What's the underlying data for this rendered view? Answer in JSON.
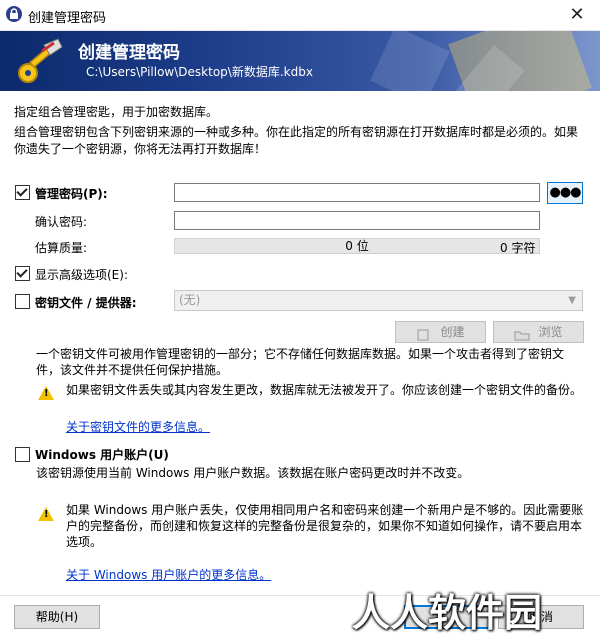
{
  "window": {
    "title": "创建管理密码"
  },
  "banner": {
    "title": "创建管理密码",
    "path": "C:\\Users\\Pillow\\Desktop\\新数据库.kdbx"
  },
  "intro": {
    "line1": "指定组合管理密匙，用于加密数据库。",
    "line2": "组合管理密钥包含下列密钥来源的一种或多种。你在此指定的所有密钥源在打开数据库时都是必须的。如果你遗失了一个密钥源，你将无法再打开数据库！"
  },
  "master_password": {
    "label": "管理密码(P):",
    "checked": true,
    "value": "",
    "dots_label": "●●●",
    "confirm_label": "确认密码:",
    "confirm_value": "",
    "quality_label": "估算质量:",
    "quality_value": "0 位",
    "char_count": "0 字符"
  },
  "advanced": {
    "label": "显示高级选项(E):",
    "checked": true
  },
  "key_file": {
    "label": "密钥文件 / 提供器:",
    "checked": false,
    "selected": "(无)",
    "create_label": "创建",
    "browse_label": "浏览",
    "desc": "一个密钥文件可被用作管理密钥的一部分；它不存储任何数据库数据。如果一个攻击者得到了密钥文件，该文件并不提供任何保护措施。",
    "warning": "如果密钥文件丢失或其内容发生更改，数据库就无法被发开了。你应该创建一个密钥文件的备份。",
    "link": "关于密钥文件的更多信息。"
  },
  "windows_account": {
    "label": "Windows 用户账户(U)",
    "checked": false,
    "desc": "该密钥源使用当前 Windows 用户账户数据。该数据在账户密码更改时并不改变。",
    "warning": "如果 Windows 用户账户丢失，仅使用相同用户名和密码来创建一个新用户是不够的。因此需要账户的完整备份，而创建和恢复这样的完整备份是很复杂的，如果你不知道如何操作，请不要启用本选项。",
    "link": "关于 Windows 用户账户的更多信息。"
  },
  "footer": {
    "help_label": "帮助(H)",
    "cancel_label": "取消"
  },
  "watermark": "人人软件园",
  "colors": {
    "accent": "#0078d7",
    "link": "#0033cc",
    "banner": "#1e3d8a",
    "warning": "#f2c200"
  },
  "icons": {
    "app": "lock-icon",
    "banner": "key-icon",
    "warning": "warning-icon",
    "close": "close-icon"
  }
}
